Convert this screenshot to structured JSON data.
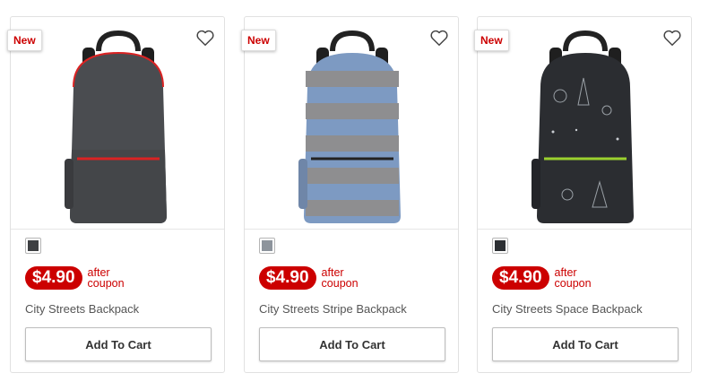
{
  "products": [
    {
      "badge": "New",
      "name": "City Streets Backpack",
      "price": "$4.90",
      "price_note_line1": "after",
      "price_note_line2": "coupon",
      "cta": "Add To Cart",
      "swatch_color": "#3d3f42",
      "bag_color": "#4a4c50",
      "zip_color": "#d92323"
    },
    {
      "badge": "New",
      "name": "City Streets Stripe Backpack",
      "price": "$4.90",
      "price_note_line1": "after",
      "price_note_line2": "coupon",
      "cta": "Add To Cart",
      "swatch_color": "#8d949c",
      "bag_color": "#7d9ac2",
      "zip_color": "#222222"
    },
    {
      "badge": "New",
      "name": "City Streets Space Backpack",
      "price": "$4.90",
      "price_note_line1": "after",
      "price_note_line2": "coupon",
      "cta": "Add To Cart",
      "swatch_color": "#2c2f33",
      "bag_color": "#2b2d31",
      "zip_color": "#9bd12e"
    }
  ],
  "colors": {
    "accent_red": "#cc0000",
    "card_border": "#e1e1e1",
    "text_gray": "#555555"
  }
}
